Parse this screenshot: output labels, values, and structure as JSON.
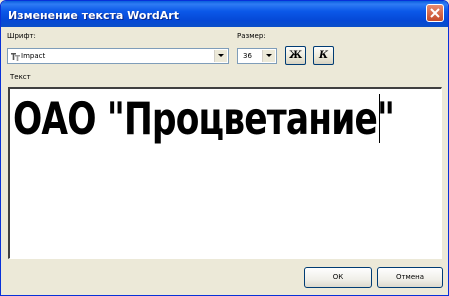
{
  "window": {
    "title": "Изменение текста WordArt"
  },
  "font": {
    "label": "Шрифт:",
    "value": "Impact"
  },
  "size": {
    "label": "Размер:",
    "value": "36"
  },
  "format": {
    "bold_label": "Ж",
    "italic_label": "К"
  },
  "text_field": {
    "label": "Текст",
    "value": "ОАО \"Процветание\""
  },
  "buttons": {
    "ok": "ОК",
    "cancel": "Отмена"
  },
  "colors": {
    "titlebar": "#0a4ec8",
    "face": "#ece9d8",
    "close": "#c44a2a"
  },
  "icons": {
    "close": "close-icon",
    "font_type": "truetype-font-icon",
    "dropdown": "chevron-down-icon"
  }
}
